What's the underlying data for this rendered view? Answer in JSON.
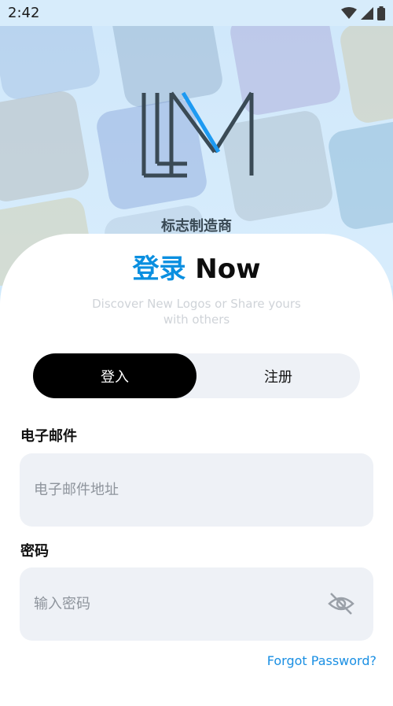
{
  "status_bar": {
    "time": "2:42"
  },
  "brand": {
    "caption": "标志制造商",
    "logo_icon": "lm-monogram-icon"
  },
  "login": {
    "title_accent": "登录",
    "title_rest": "Now",
    "subtitle": "Discover New Logos or Share yours with others"
  },
  "tabs": [
    {
      "label": "登入",
      "active": true
    },
    {
      "label": "注册",
      "active": false
    }
  ],
  "form": {
    "email_label": "电子邮件",
    "email_placeholder": "电子邮件地址",
    "password_label": "密码",
    "password_placeholder": "输入密码",
    "visibility_icon": "eye-off-icon",
    "forgot_label": "Forgot Password?"
  },
  "colors": {
    "accent": "#0a8fe0",
    "link": "#1a8fe3",
    "field_bg": "#eef1f6",
    "active_tab_bg": "#000000"
  }
}
